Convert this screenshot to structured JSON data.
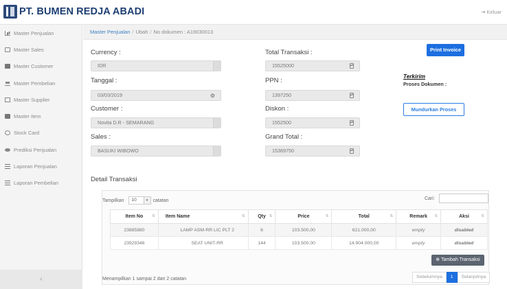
{
  "header": {
    "brand": "PT. BUMEN REDJA ABADI",
    "logout_label": "Keluar"
  },
  "sidebar": {
    "items": [
      {
        "label": "Master Penjualan",
        "icon": "chart-icon"
      },
      {
        "label": "Master Sales",
        "icon": "id-card-icon"
      },
      {
        "label": "Master Customer",
        "icon": "customer-icon"
      },
      {
        "label": "Master Pembelian",
        "icon": "cart-icon"
      },
      {
        "label": "Master Supplier",
        "icon": "supplier-icon"
      },
      {
        "label": "Master Item",
        "icon": "item-icon"
      },
      {
        "label": "Stock Card",
        "icon": "stock-icon"
      },
      {
        "label": "Prediksi Penjualan",
        "icon": "eye-icon"
      },
      {
        "label": "Laporan Penjualan",
        "icon": "report-icon"
      },
      {
        "label": "Laporan Pembelian",
        "icon": "report-icon"
      }
    ],
    "collapse_label": "‹"
  },
  "breadcrumb": {
    "root": "Master Penjualan",
    "sep": "/",
    "page": "Ubah",
    "doc": "No dokumen : A19030013"
  },
  "form": {
    "currency_label": "Currency :",
    "currency_value": "IDR",
    "tanggal_label": "Tanggal :",
    "tanggal_value": "03/03/2019",
    "customer_label": "Customer :",
    "customer_value": "Novita D.R - SEMARANG",
    "sales_label": "Sales :",
    "sales_value": "BASUKI WIBOWO",
    "total_label": "Total Transaksi :",
    "total_value": "15525000",
    "ppn_label": "PPN :",
    "ppn_value": "1397250",
    "diskon_label": "Diskon :",
    "diskon_value": "1552500",
    "grand_label": "Grand Total :",
    "grand_value": "15369750"
  },
  "actions": {
    "print_label": "Print Invoice",
    "status_title": "Terkirim",
    "status_sub": "Proses Dokumen :",
    "mundur_label": "Mundurkan Proses"
  },
  "detail": {
    "title": "Detail Transaksi",
    "show_prefix": "Tampilkan",
    "show_value": "10",
    "show_suffix": "catatan",
    "search_label": "Cari:",
    "columns": [
      "Item No",
      "Item Name",
      "Qty",
      "Price",
      "Total",
      "Remark",
      "Aksi"
    ],
    "rows": [
      {
        "item_no": "23885880",
        "item_name": "LAMP ASM-RR LIC PLT 2",
        "qty": "6",
        "price": "103.500,00",
        "total": "621.000,00",
        "remark": "empty",
        "aksi": "disabled"
      },
      {
        "item_no": "23929346",
        "item_name": "SEAT UNIT-RR",
        "qty": "144",
        "price": "103.500,00",
        "total": "14.904.000,00",
        "remark": "empty",
        "aksi": "disabled"
      }
    ],
    "add_label": "Tambah Transaksi",
    "info": "Menampilkan 1 sampai 2 dari 2 catatan",
    "prev_label": "Sebelumnya",
    "page_label": "1",
    "next_label": "Selanjutnya"
  }
}
